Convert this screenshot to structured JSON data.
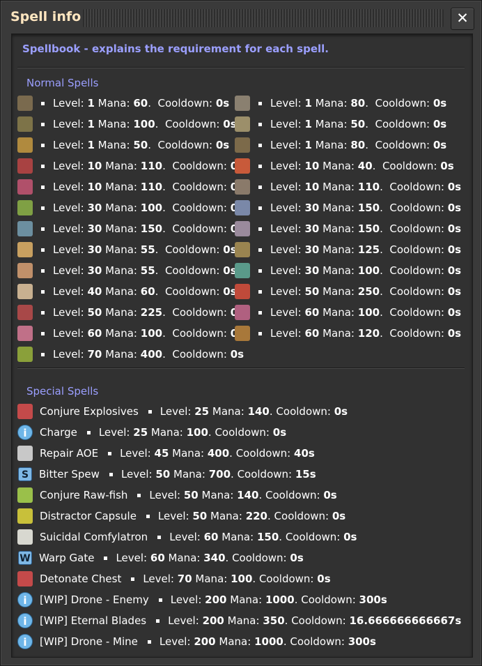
{
  "window": {
    "title": "Spell info",
    "close_symbol": "✕"
  },
  "intro": "Spellbook - explains the requirement for each spell.",
  "normal": {
    "heading": "Normal Spells",
    "level_label": "Level:",
    "mana_label": "Mana:",
    "cooldown_label": "Cooldown:",
    "spells": [
      {
        "icon": "stone-furnace-icon",
        "color": "#7a6a4e",
        "level": "1",
        "mana": "60",
        "cooldown": "0s"
      },
      {
        "icon": "walls-icon",
        "color": "#8a8070",
        "level": "1",
        "mana": "80",
        "cooldown": "0s"
      },
      {
        "icon": "grenade-icon",
        "color": "#7d7348",
        "level": "1",
        "mana": "100",
        "cooldown": "0s"
      },
      {
        "icon": "landmine-icon",
        "color": "#9c8f6a",
        "level": "1",
        "mana": "50",
        "cooldown": "0s"
      },
      {
        "icon": "wooden-chest-icon",
        "color": "#b08a3e",
        "level": "1",
        "mana": "50",
        "cooldown": "0s"
      },
      {
        "icon": "rock-icon",
        "color": "#7c6a4a",
        "level": "1",
        "mana": "80",
        "cooldown": "0s"
      },
      {
        "icon": "inserter-red-icon",
        "color": "#a84242",
        "level": "10",
        "mana": "110",
        "cooldown": "0s"
      },
      {
        "icon": "gun-turret-icon",
        "color": "#c85a3a",
        "level": "10",
        "mana": "40",
        "cooldown": "0s"
      },
      {
        "icon": "red-walls-icon",
        "color": "#b0506a",
        "level": "10",
        "mana": "110",
        "cooldown": "0s"
      },
      {
        "icon": "steel-chest-icon",
        "color": "#8a7a6a",
        "level": "10",
        "mana": "110",
        "cooldown": "0s"
      },
      {
        "icon": "tree-icon",
        "color": "#7fa044",
        "level": "30",
        "mana": "100",
        "cooldown": "0s"
      },
      {
        "icon": "blue-walls-icon",
        "color": "#7a88a8",
        "level": "30",
        "mana": "150",
        "cooldown": "0s"
      },
      {
        "icon": "splitter-blue-icon",
        "color": "#6c8fa0",
        "level": "30",
        "mana": "150",
        "cooldown": "0s"
      },
      {
        "icon": "gate-icon",
        "color": "#9a8a9c",
        "level": "30",
        "mana": "150",
        "cooldown": "0s"
      },
      {
        "icon": "small-biter-icon",
        "color": "#c8a060",
        "level": "30",
        "mana": "55",
        "cooldown": "0s"
      },
      {
        "icon": "rocket-icon",
        "color": "#9a8450",
        "level": "30",
        "mana": "125",
        "cooldown": "0s"
      },
      {
        "icon": "medium-biter-icon",
        "color": "#c0906a",
        "level": "30",
        "mana": "55",
        "cooldown": "0s"
      },
      {
        "icon": "spitter-icon",
        "color": "#5a9a8a",
        "level": "30",
        "mana": "100",
        "cooldown": "0s"
      },
      {
        "icon": "shotgun-shell-icon",
        "color": "#c8b090",
        "level": "40",
        "mana": "60",
        "cooldown": "0s"
      },
      {
        "icon": "red-rocket-icon",
        "color": "#c04a3a",
        "level": "50",
        "mana": "250",
        "cooldown": "0s"
      },
      {
        "icon": "behemoth-biter-icon",
        "color": "#a84848",
        "level": "50",
        "mana": "225",
        "cooldown": "0s"
      },
      {
        "icon": "big-spitter-icon",
        "color": "#b06080",
        "level": "60",
        "mana": "100",
        "cooldown": "0s"
      },
      {
        "icon": "big-biter-icon",
        "color": "#c07088",
        "level": "60",
        "mana": "100",
        "cooldown": "0s"
      },
      {
        "icon": "explosive-cannon-icon",
        "color": "#a8783a",
        "level": "60",
        "mana": "120",
        "cooldown": "0s"
      },
      {
        "icon": "atomic-bomb-icon",
        "color": "#8aa03a",
        "level": "70",
        "mana": "400",
        "cooldown": "0s"
      }
    ]
  },
  "special": {
    "heading": "Special Spells",
    "level_label": "Level:",
    "mana_label": "Mana:",
    "cooldown_label": "Cooldown:",
    "spells": [
      {
        "icon": "explosives-icon",
        "kind": "item",
        "color": "#c44a4a",
        "name": "Conjure Explosives",
        "level": "25",
        "mana": "140",
        "cooldown": "0s"
      },
      {
        "icon": "info-icon",
        "kind": "info",
        "glyph": "i",
        "name": "Charge",
        "level": "25",
        "mana": "100",
        "cooldown": "0s"
      },
      {
        "icon": "repair-tools-icon",
        "kind": "item",
        "color": "#c8c8c8",
        "name": "Repair AOE",
        "level": "45",
        "mana": "400",
        "cooldown": "40s"
      },
      {
        "icon": "letter-s-icon",
        "kind": "letter",
        "glyph": "S",
        "name": "Bitter Spew",
        "level": "50",
        "mana": "700",
        "cooldown": "15s"
      },
      {
        "icon": "raw-fish-icon",
        "kind": "item",
        "color": "#9ac04a",
        "name": "Conjure Raw-fish",
        "level": "50",
        "mana": "140",
        "cooldown": "0s"
      },
      {
        "icon": "distractor-capsule-icon",
        "kind": "item",
        "color": "#c8c03a",
        "name": "Distractor Capsule",
        "level": "50",
        "mana": "220",
        "cooldown": "0s"
      },
      {
        "icon": "comfylatron-icon",
        "kind": "item",
        "color": "#d8d8d0",
        "name": "Suicidal Comfylatron",
        "level": "60",
        "mana": "150",
        "cooldown": "0s"
      },
      {
        "icon": "letter-w-icon",
        "kind": "letter",
        "glyph": "W",
        "name": "Warp Gate",
        "level": "60",
        "mana": "340",
        "cooldown": "0s"
      },
      {
        "icon": "detonate-chest-icon",
        "kind": "item",
        "color": "#c44a4a",
        "name": "Detonate Chest",
        "level": "70",
        "mana": "100",
        "cooldown": "0s"
      },
      {
        "icon": "info-icon",
        "kind": "info",
        "glyph": "i",
        "name": "[WIP] Drone - Enemy",
        "level": "200",
        "mana": "1000",
        "cooldown": "300s"
      },
      {
        "icon": "info-icon",
        "kind": "info",
        "glyph": "i",
        "name": "[WIP] Eternal Blades",
        "level": "200",
        "mana": "350",
        "cooldown": "16.666666666667s"
      },
      {
        "icon": "info-icon",
        "kind": "info",
        "glyph": "i",
        "name": "[WIP] Drone - Mine",
        "level": "200",
        "mana": "1000",
        "cooldown": "300s"
      }
    ]
  }
}
